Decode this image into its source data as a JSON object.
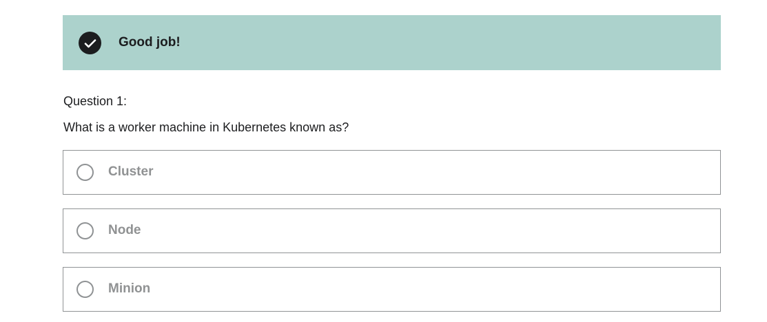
{
  "feedback": {
    "icon": "check-circle-icon",
    "message": "Good job!",
    "background_color": "#acd2cc"
  },
  "question": {
    "number_label": "Question 1:",
    "text": "What is a worker machine in Kubernetes known as?"
  },
  "options": [
    {
      "label": "Cluster",
      "selected": false
    },
    {
      "label": "Node",
      "selected": false
    },
    {
      "label": "Minion",
      "selected": false
    }
  ]
}
